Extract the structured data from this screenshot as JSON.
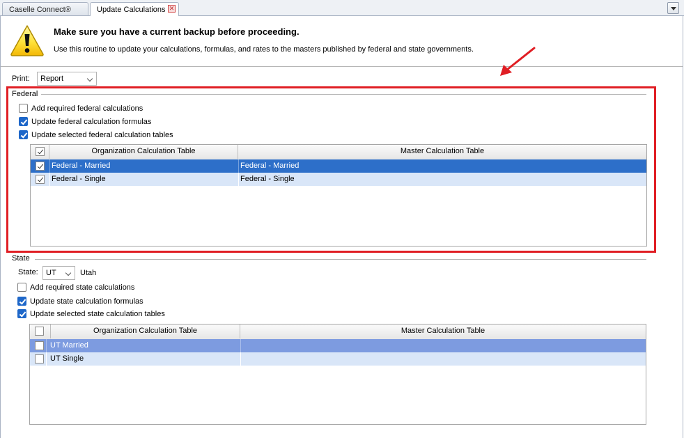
{
  "tabs": [
    {
      "label": "Caselle Connect®",
      "active": false
    },
    {
      "label": "Update Calculations",
      "active": true,
      "close_icon": "close-x-icon"
    }
  ],
  "tab_menu_icon": "chevron-down-icon",
  "header": {
    "icon": "warning-icon",
    "title": "Make sure you have a current backup before proceeding.",
    "description": "Use this routine to update your calculations, formulas, and rates to the masters published by federal and state governments."
  },
  "print": {
    "label": "Print:",
    "value": "Report"
  },
  "federal": {
    "title": "Federal",
    "options": [
      {
        "label": "Add required federal calculations",
        "checked": false
      },
      {
        "label": "Update federal calculation formulas",
        "checked": true
      },
      {
        "label": "Update selected federal calculation tables",
        "checked": true
      }
    ],
    "table": {
      "columns": [
        "Organization Calculation Table",
        "Master Calculation Table"
      ],
      "header_checked": true,
      "rows": [
        {
          "org": "Federal - Married",
          "master": "Federal - Married",
          "checked": true,
          "selected": true
        },
        {
          "org": "Federal - Single",
          "master": "Federal - Single",
          "checked": true,
          "selected": false
        }
      ]
    }
  },
  "state": {
    "title": "State",
    "state_label": "State:",
    "state_value": "UT",
    "state_name": "Utah",
    "options": [
      {
        "label": "Add required state calculations",
        "checked": false
      },
      {
        "label": "Update state calculation formulas",
        "checked": true
      },
      {
        "label": "Update selected state calculation tables",
        "checked": true
      }
    ],
    "table": {
      "columns": [
        "Organization Calculation Table",
        "Master Calculation Table"
      ],
      "header_checked": false,
      "rows": [
        {
          "org": "UT Married",
          "master": "",
          "checked": false,
          "selected": true
        },
        {
          "org": "UT Single",
          "master": "",
          "checked": false,
          "selected": false
        }
      ]
    }
  },
  "colors": {
    "selected_row": "#2d6fc9",
    "selected_row_state": "#7d9be0",
    "alt_row": "#d9e6f8",
    "checkbox_accent": "#1e67c9",
    "annotation": "#e01e24"
  }
}
